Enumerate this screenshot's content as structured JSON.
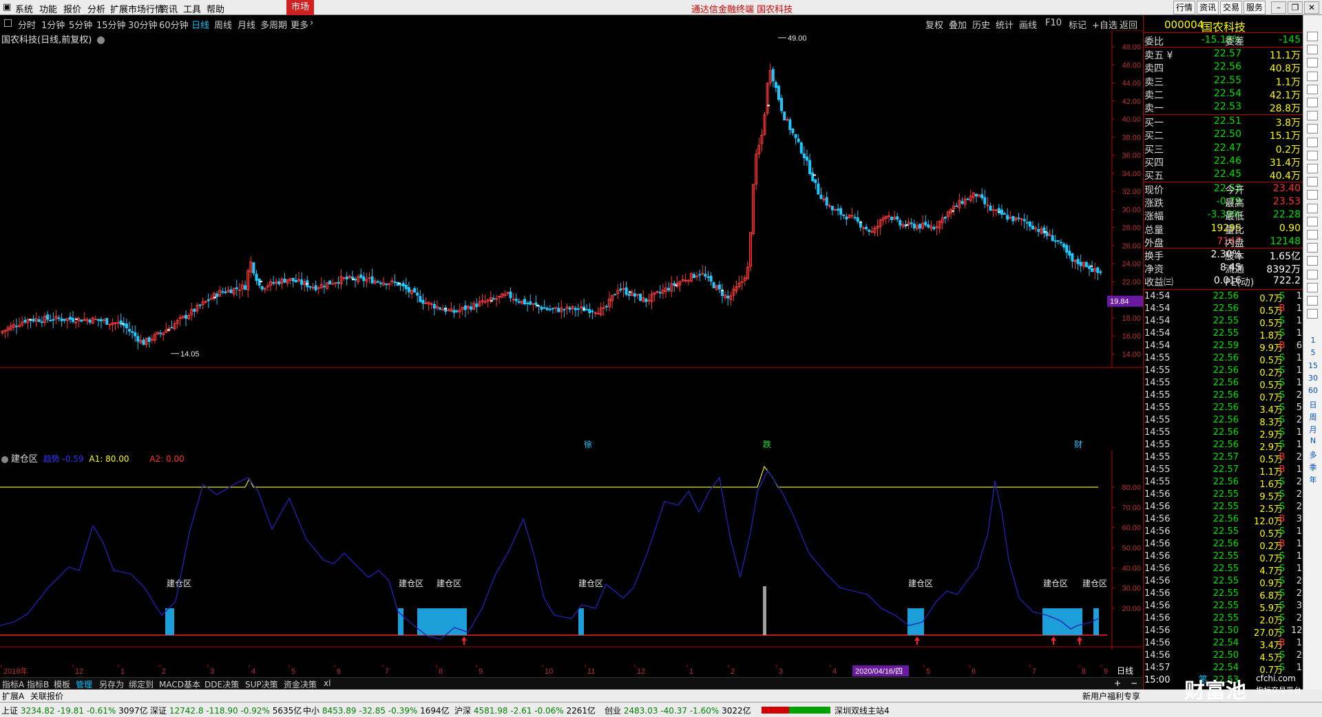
{
  "menu": {
    "items": [
      "系统",
      "功能",
      "报价",
      "分析",
      "扩展市场行情",
      "资讯",
      "工具",
      "帮助"
    ],
    "market": "市场",
    "center_title": "通达信金融终端  国农科技",
    "right_buttons": [
      "行情",
      "资讯",
      "交易",
      "服务"
    ]
  },
  "periods": {
    "items": [
      "分时",
      "1分钟",
      "5分钟",
      "15分钟",
      "30分钟",
      "60分钟",
      "日线",
      "周线",
      "月线",
      "多周期",
      "更多"
    ],
    "active": "日线",
    "tools": [
      "复权",
      "叠加",
      "历史",
      "统计",
      "画线",
      "F10",
      "标记",
      "+自选",
      "返回"
    ]
  },
  "chart": {
    "title": "国农科技(日线,前复权)",
    "high_label": "49.00",
    "low_label": "14.05",
    "current_price_tag": "19.84",
    "y_ticks": [
      "48.00",
      "46.00",
      "44.00",
      "42.00",
      "40.00",
      "38.00",
      "36.00",
      "34.00",
      "32.00",
      "30.00",
      "28.00",
      "26.00",
      "24.00",
      "22.00",
      "20.00",
      "18.00",
      "16.00",
      "14.00"
    ],
    "event_markers": [
      "徐",
      "跌",
      "财"
    ]
  },
  "indicator": {
    "name": "建仓区",
    "legend": [
      {
        "key": "趋势",
        "value": "-0.59",
        "color": "#3030ff"
      },
      {
        "key": "A1",
        "value": "80.00",
        "color": "#ffff00"
      },
      {
        "key": "A2",
        "value": "0.00",
        "color": "#ff3030"
      }
    ],
    "zone_label": "建仓区",
    "y_ticks": [
      "80.00",
      "70.00",
      "60.00",
      "50.00",
      "40.00",
      "30.00",
      "20.00"
    ]
  },
  "xaxis": {
    "labels": [
      "2018年",
      "12",
      "1",
      "2",
      "3",
      "4",
      "5",
      "6",
      "7",
      "8",
      "9",
      "10",
      "11",
      "12",
      "1",
      "2",
      "3",
      "4",
      "5",
      "6",
      "7",
      "8",
      "9"
    ],
    "date_highlight": "2020/04/16/四",
    "period_label": "日线"
  },
  "bottom_tabs": {
    "items": [
      "指标A",
      "指标B",
      "模板",
      "管理",
      "另存为",
      "绑定到",
      "MACD基本",
      "DDE决策",
      "SUP决策",
      "资金决策",
      "xl"
    ],
    "active": "管理"
  },
  "ext_bar": {
    "items": [
      "扩展A",
      "关联报价"
    ],
    "promo": "新用户福利专享"
  },
  "status": {
    "indices": [
      {
        "name": "上证",
        "value": "3234.82",
        "change": "-19.81",
        "pct": "-0.61%",
        "amount": "3097亿"
      },
      {
        "name": "深证",
        "value": "12742.8",
        "change": "-118.90",
        "pct": "-0.92%",
        "amount": "5635亿"
      },
      {
        "name": "中小",
        "value": "8453.89",
        "change": "-32.85",
        "pct": "-0.39%",
        "amount": "1694亿"
      },
      {
        "name": "沪深",
        "value": "4581.98",
        "change": "-2.61",
        "pct": "-0.06%",
        "amount": "2261亿"
      },
      {
        "name": "创业",
        "value": "2483.03",
        "change": "-40.37",
        "pct": "-1.60%",
        "amount": "3022亿"
      }
    ],
    "server": "深圳双线主站4"
  },
  "quote": {
    "code": "000004",
    "name": "国农科技",
    "weibi": {
      "label": "委比",
      "value": "-15.18%",
      "label2": "委差",
      "value2": "-145"
    },
    "asks": [
      {
        "label": "卖五",
        "price": "22.57",
        "vol": "11.1万"
      },
      {
        "label": "卖四",
        "price": "22.56",
        "vol": "40.8万"
      },
      {
        "label": "卖三",
        "price": "22.55",
        "vol": "1.1万"
      },
      {
        "label": "卖二",
        "price": "22.54",
        "vol": "42.1万"
      },
      {
        "label": "卖一",
        "price": "22.53",
        "vol": "28.8万"
      }
    ],
    "bids": [
      {
        "label": "买一",
        "price": "22.51",
        "vol": "3.8万"
      },
      {
        "label": "买二",
        "price": "22.50",
        "vol": "15.1万"
      },
      {
        "label": "买三",
        "price": "22.47",
        "vol": "0.2万"
      },
      {
        "label": "买四",
        "price": "22.46",
        "vol": "31.4万"
      },
      {
        "label": "买五",
        "price": "22.45",
        "vol": "40.4万"
      }
    ],
    "stats": [
      {
        "l": "现价",
        "v": "22.53",
        "l2": "今开",
        "v2": "23.40",
        "c": "dn",
        "c2": "up"
      },
      {
        "l": "涨跌",
        "v": "-0.79",
        "l2": "最高",
        "v2": "23.53",
        "c": "dn",
        "c2": "up"
      },
      {
        "l": "涨幅",
        "v": "-3.39%",
        "l2": "最低",
        "v2": "22.28",
        "c": "dn",
        "c2": "dn"
      },
      {
        "l": "总量",
        "v": "19295",
        "l2": "量比",
        "v2": "0.90",
        "c": "yl",
        "c2": "yl"
      },
      {
        "l": "外盘",
        "v": "7147",
        "l2": "内盘",
        "v2": "12148",
        "c": "up",
        "c2": "dn"
      },
      {
        "l": "换手",
        "v": "2.30%",
        "l2": "股本",
        "v2": "1.65亿",
        "c": "wt",
        "c2": "wt"
      },
      {
        "l": "净资",
        "v": "8.45",
        "l2": "流通",
        "v2": "8392万",
        "c": "wt",
        "c2": "wt"
      },
      {
        "l": "收益㈢",
        "v": "0.016",
        "l2": "PE(动)",
        "v2": "722.2",
        "c": "wt",
        "c2": "wt"
      }
    ],
    "ticks": [
      [
        "14:54",
        "22.56",
        "0.7万",
        "S",
        "1"
      ],
      [
        "14:54",
        "22.56",
        "0.5万",
        "B",
        "1"
      ],
      [
        "14:54",
        "22.55",
        "0.5万",
        "S",
        "1"
      ],
      [
        "14:54",
        "22.55",
        "1.8万",
        "S",
        "1"
      ],
      [
        "14:54",
        "22.59",
        "9.9万",
        "B",
        "6"
      ],
      [
        "14:55",
        "22.56",
        "0.5万",
        "S",
        "1"
      ],
      [
        "14:55",
        "22.56",
        "0.2万",
        "S",
        "1"
      ],
      [
        "14:55",
        "22.56",
        "0.5万",
        "S",
        "1"
      ],
      [
        "14:55",
        "22.56",
        "0.7万",
        "S",
        "2"
      ],
      [
        "14:55",
        "22.56",
        "3.4万",
        "S",
        "5"
      ],
      [
        "14:55",
        "22.56",
        "8.3万",
        "S",
        "2"
      ],
      [
        "14:55",
        "22.56",
        "2.9万",
        "S",
        "1"
      ],
      [
        "14:55",
        "22.56",
        "2.9万",
        "S",
        "1"
      ],
      [
        "14:55",
        "22.57",
        "0.5万",
        "B",
        "2"
      ],
      [
        "14:55",
        "22.57",
        "1.1万",
        "B",
        "1"
      ],
      [
        "14:55",
        "22.56",
        "1.6万",
        "S",
        "2"
      ],
      [
        "14:56",
        "22.55",
        "9.5万",
        "S",
        "2"
      ],
      [
        "14:56",
        "22.55",
        "2.5万",
        "S",
        "2"
      ],
      [
        "14:56",
        "22.56",
        "12.0万",
        "B",
        "3"
      ],
      [
        "14:56",
        "22.55",
        "0.5万",
        "S",
        "1"
      ],
      [
        "14:56",
        "22.56",
        "0.2万",
        "B",
        "1"
      ],
      [
        "14:56",
        "22.55",
        "0.7万",
        "S",
        "1"
      ],
      [
        "14:56",
        "22.55",
        "4.7万",
        "S",
        "1"
      ],
      [
        "14:56",
        "22.55",
        "0.9万",
        "S",
        "2"
      ],
      [
        "14:56",
        "22.55",
        "6.8万",
        "S",
        "2"
      ],
      [
        "14:56",
        "22.55",
        "5.9万",
        "S",
        "3"
      ],
      [
        "14:56",
        "22.55",
        "2.0万",
        "S",
        "2"
      ],
      [
        "14:56",
        "22.50",
        "27.0万",
        "S",
        "12"
      ],
      [
        "14:56",
        "22.54",
        "3.4万",
        "B",
        "1"
      ],
      [
        "14:56",
        "22.50",
        "4.5万",
        "S",
        "2"
      ],
      [
        "14:57",
        "22.54",
        "0.7万",
        "S",
        "1"
      ],
      [
        "15:00",
        "22.53",
        "",
        "",
        " "
      ]
    ],
    "footer_tab": "笔"
  },
  "sidetools_labels": [
    "1",
    "5",
    "15",
    "30",
    "60",
    "日",
    "周",
    "月",
    "N",
    "多",
    "季",
    "年"
  ],
  "watermark": {
    "text": "财富池",
    "sub": "cfchi.com",
    "sub2": "指标交易平台"
  },
  "colors": {
    "up": "#ff3030",
    "down": "#00c8ff",
    "border": "#c00000",
    "trend": "#1a1aa0",
    "zone": "#1c9ed8",
    "a1": "#e8e800"
  }
}
